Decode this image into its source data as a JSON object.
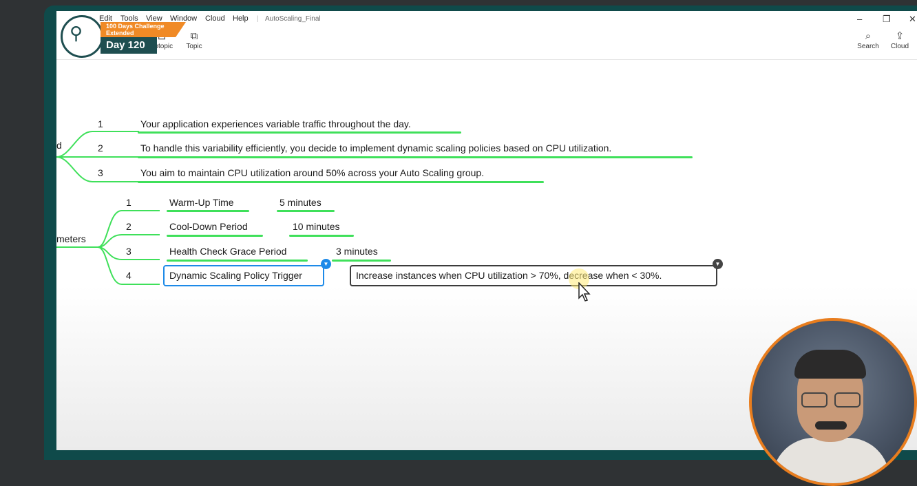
{
  "menu": [
    "Edit",
    "Tools",
    "View",
    "Window",
    "Cloud",
    "Help"
  ],
  "document_title": "AutoScaling_Final",
  "toolbar": {
    "subtopic_label": "ubtopic",
    "topic_label": "Topic",
    "search_label": "Search",
    "cloud_label": "Cloud"
  },
  "badge": {
    "line1": "100 Days Challenge",
    "line2": "Extended",
    "day": "Day 120"
  },
  "branch_scenario": {
    "parent_fragment": "d",
    "items": [
      {
        "num": "1",
        "text": "Your application experiences variable traffic throughout the day."
      },
      {
        "num": "2",
        "text": "To handle this variability efficiently, you decide to implement dynamic scaling policies based on CPU utilization."
      },
      {
        "num": "3",
        "text": "You aim to maintain CPU utilization around 50% across your Auto Scaling group."
      }
    ]
  },
  "branch_parameters": {
    "parent_fragment": "meters",
    "items": [
      {
        "num": "1",
        "name": "Warm-Up Time",
        "value": "5 minutes"
      },
      {
        "num": "2",
        "name": "Cool-Down Period",
        "value": "10 minutes"
      },
      {
        "num": "3",
        "name": "Health Check Grace Period",
        "value": "3 minutes"
      },
      {
        "num": "4",
        "name": "Dynamic Scaling Policy Trigger",
        "value": "Increase instances when CPU utilization > 70%, decrease when < 30%."
      }
    ]
  },
  "colors": {
    "branch_line": "#3fe05a",
    "selection": "#1d8ae8",
    "editing_box": "#3c3c3c",
    "brand_orange": "#f08a26",
    "brand_teal": "#1e4e50"
  }
}
